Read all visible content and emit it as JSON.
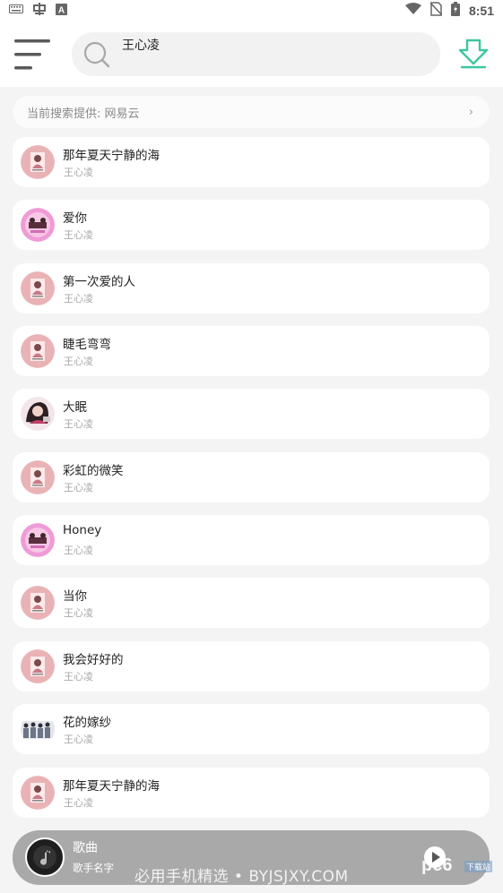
{
  "status_bar": {
    "time": "8:51",
    "left_icons": [
      "keyboard-icon",
      "app-icon",
      "a-badge-icon"
    ],
    "right_icons": [
      "wifi-icon",
      "no-sim-icon",
      "battery-charging-icon"
    ]
  },
  "header": {
    "search_value": "王心凌",
    "accent_color": "#3dc6a0"
  },
  "provider": {
    "label": "当前搜索提供: 网易云",
    "arrow": "›"
  },
  "songs": [
    {
      "title": "那年夏天宁静的海",
      "artist": "王心凌",
      "cover": "pink"
    },
    {
      "title": "爱你",
      "artist": "王心凌",
      "cover": "magenta"
    },
    {
      "title": "第一次爱的人",
      "artist": "王心凌",
      "cover": "pink"
    },
    {
      "title": "睫毛弯弯",
      "artist": "王心凌",
      "cover": "pink"
    },
    {
      "title": "大眠",
      "artist": "王心凌",
      "cover": "dark"
    },
    {
      "title": "彩虹的微笑",
      "artist": "王心凌",
      "cover": "pink"
    },
    {
      "title": "Honey",
      "artist": "王心凌",
      "cover": "magenta"
    },
    {
      "title": "当你",
      "artist": "王心凌",
      "cover": "pink"
    },
    {
      "title": "我会好好的",
      "artist": "王心凌",
      "cover": "pink"
    },
    {
      "title": "花的嫁纱",
      "artist": "王心凌",
      "cover": "group"
    },
    {
      "title": "那年夏天宁静的海",
      "artist": "王心凌",
      "cover": "pink"
    }
  ],
  "player": {
    "title": "歌曲",
    "artist": "歌手名字"
  },
  "watermark": {
    "text": "必用手机精选 • BYJSJXY.COM",
    "logo": "pc6",
    "logo_sub": "下载站"
  }
}
